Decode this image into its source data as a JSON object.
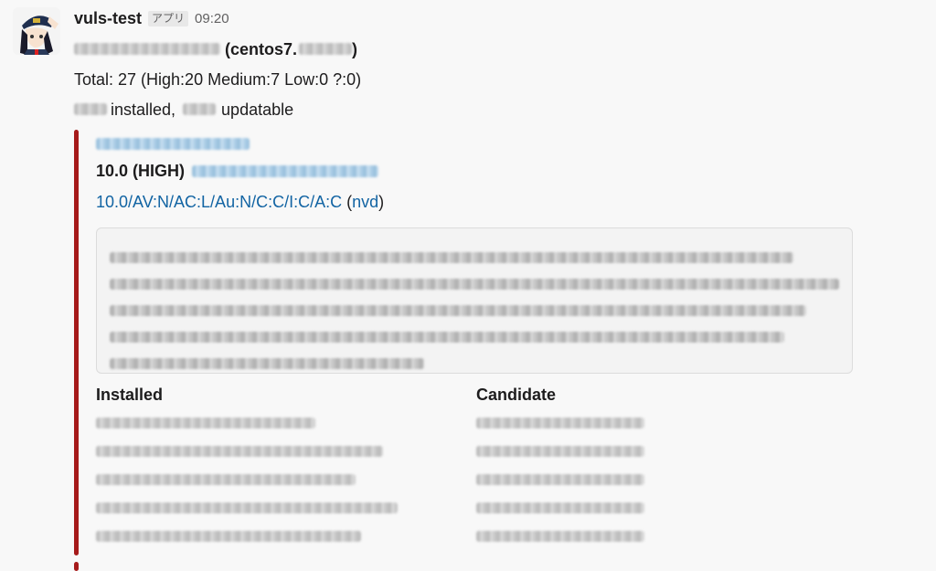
{
  "message": {
    "sender": "vuls-test",
    "app_badge": "アプリ",
    "time": "09:20",
    "server_suffix": "(centos7.",
    "server_close": ")",
    "total": "Total: 27 (High:20 Medium:7 Low:0 ?:0)",
    "installed_text": "installed,",
    "updatable_text": "updatable"
  },
  "attachment": {
    "color": "#a61a1a",
    "severity": "10.0 (HIGH)",
    "vector": "10.0/AV:N/AC:L/Au:N/C:C/I:C/A:C",
    "source_open": "(",
    "source": "nvd",
    "source_close": ")",
    "table": {
      "headers": [
        "Installed",
        "Candidate"
      ]
    }
  }
}
